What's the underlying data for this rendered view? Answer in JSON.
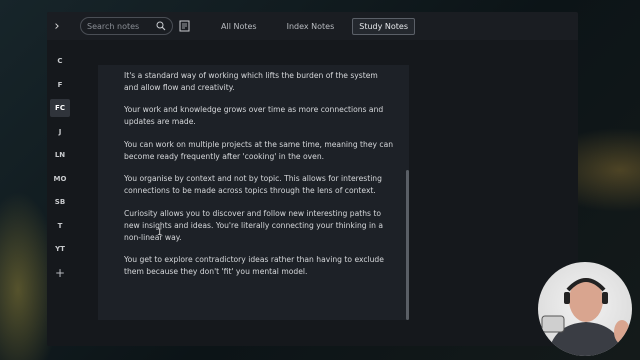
{
  "app": {
    "search": {
      "placeholder": "Search notes"
    },
    "tabs": [
      {
        "label": "All Notes"
      },
      {
        "label": "Index Notes"
      },
      {
        "label": "Study Notes",
        "active": true
      }
    ],
    "sidebar": {
      "items": [
        {
          "label": "C"
        },
        {
          "label": "F"
        },
        {
          "label": "FC",
          "active": true
        },
        {
          "label": "J"
        },
        {
          "label": "LN"
        },
        {
          "label": "MO"
        },
        {
          "label": "SB"
        },
        {
          "label": "T"
        },
        {
          "label": "YT"
        },
        {
          "label": "+"
        }
      ]
    },
    "note": {
      "paragraphs": [
        "It's a standard way of working which lifts the burden of the system and allow flow and creativity.",
        "Your work and knowledge grows over time as more connections and updates are made.",
        "You can work on multiple projects at the same time, meaning they can become ready frequently after 'cooking' in the oven.",
        "You organise by context and not by topic. This allows for interesting connections to be made across topics through the lens of context.",
        "Curiosity allows you to discover and follow new interesting paths to new insights and ideas. You're literally connecting your thinking in a non-linear way.",
        "You get to explore contradictory ideas rather than having to exclude them because they don't 'fit' you mental model."
      ]
    }
  },
  "icons": {
    "sidebar_toggle": "chevron-right-icon",
    "search": "search-icon",
    "new_note": "edit-note-icon",
    "text_cursor": "i-beam-cursor-icon"
  },
  "colors": {
    "background": "#0d1518",
    "app_background": "#15181c",
    "topbar": "#1a1d22",
    "editor": "#1d2127",
    "text": "#d6d8db",
    "active_tab_border": "#5b6068"
  }
}
